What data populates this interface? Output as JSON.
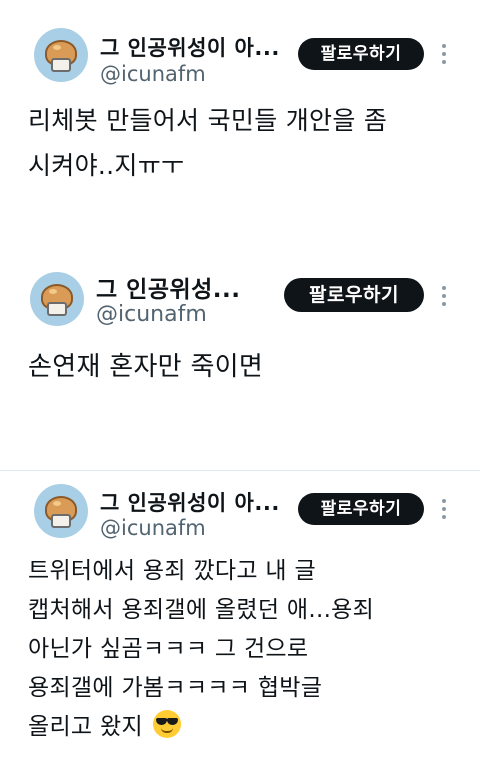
{
  "posts": [
    {
      "display_name": "그 인공위성이 아...",
      "handle": "@icunafm",
      "follow_label": "팔로우하기",
      "text_lines": [
        "리체봇 만들어서 국민들 개안을 좀",
        "시켜야..지ㅠㅜ"
      ]
    },
    {
      "display_name": "그 인공위성...",
      "handle": "@icunafm",
      "follow_label": "팔로우하기",
      "text_lines": [
        "손연재 혼자만 죽이면"
      ]
    },
    {
      "display_name": "그 인공위성이 아...",
      "handle": "@icunafm",
      "follow_label": "팔로우하기",
      "text_lines": [
        "트위터에서 용죄 깠다고 내 글",
        "캡처해서 용죄갤에 올렸던 애...용죄",
        "아닌가 싶곰ㅋㅋㅋ 그 건으로",
        "용죄갤에 가봄ㅋㅋㅋㅋ 협박글",
        "올리고 왔지"
      ]
    }
  ],
  "icons": {
    "avatar": "bread-avatar-icon",
    "more": "more-vertical-icon",
    "emoji": "sunglasses-emoji-icon"
  }
}
